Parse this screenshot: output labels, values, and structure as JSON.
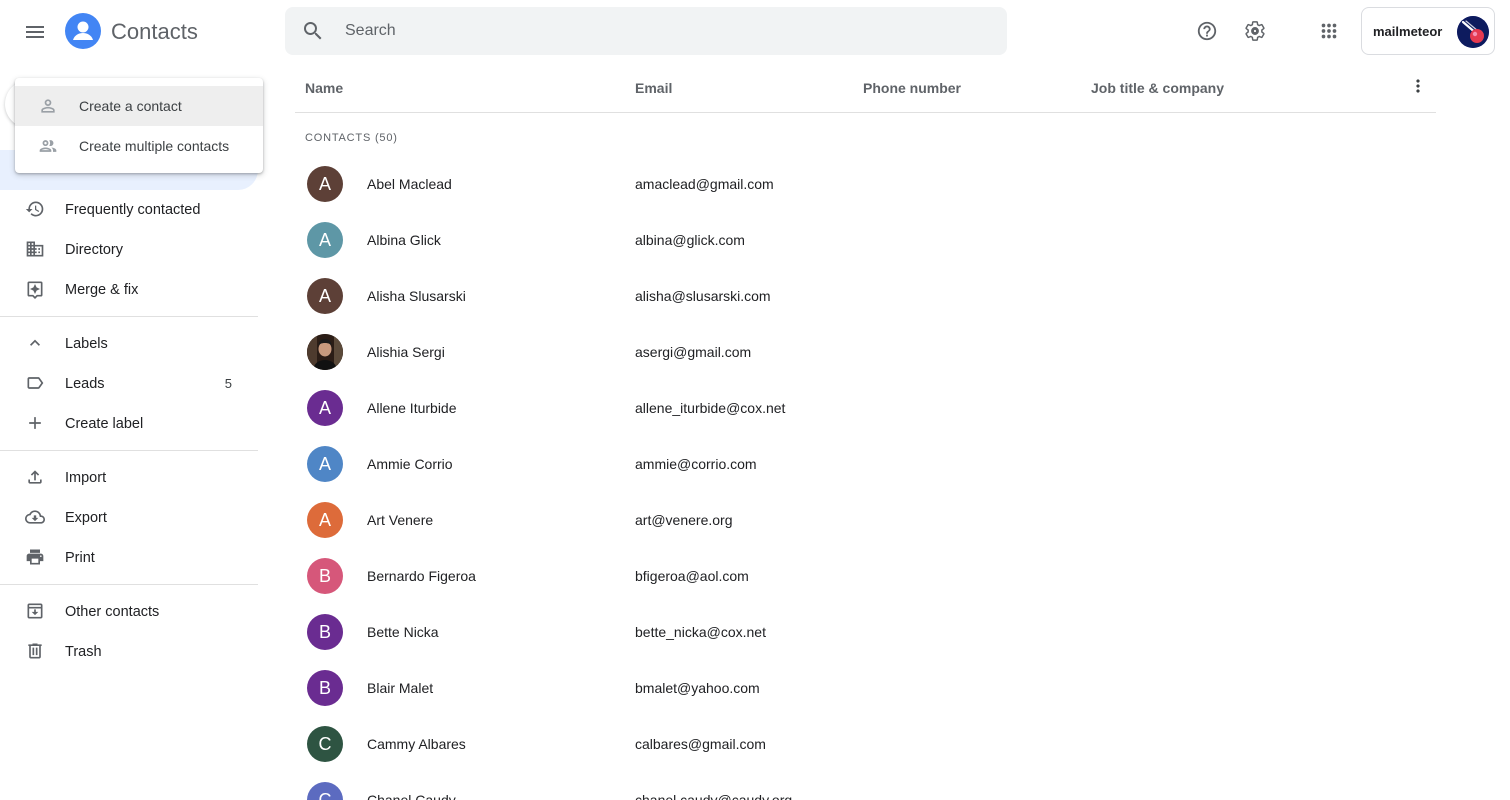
{
  "header": {
    "app_title": "Contacts",
    "search_placeholder": "Search",
    "brand_name": "mailmeteor"
  },
  "dropdown": {
    "items": [
      {
        "label": "Create a contact",
        "icon": "person-icon"
      },
      {
        "label": "Create multiple contacts",
        "icon": "people-icon"
      }
    ]
  },
  "sidebar": {
    "items": [
      {
        "label": "Frequently contacted",
        "icon": "history-icon"
      },
      {
        "label": "Directory",
        "icon": "building-icon"
      },
      {
        "label": "Merge & fix",
        "icon": "merge-fix-icon"
      }
    ],
    "labels_header": "Labels",
    "labels": [
      {
        "label": "Leads",
        "count": "5",
        "icon": "label-icon"
      }
    ],
    "create_label": "Create label",
    "actions": [
      {
        "label": "Import",
        "icon": "upload-icon"
      },
      {
        "label": "Export",
        "icon": "cloud-download-icon"
      },
      {
        "label": "Print",
        "icon": "printer-icon"
      }
    ],
    "bottom": [
      {
        "label": "Other contacts",
        "icon": "archive-icon"
      },
      {
        "label": "Trash",
        "icon": "trash-icon"
      }
    ]
  },
  "list": {
    "columns": {
      "name": "Name",
      "email": "Email",
      "phone": "Phone number",
      "job": "Job title & company"
    },
    "section_title": "CONTACTS (50)",
    "contacts": [
      {
        "initial": "A",
        "name": "Abel Maclead",
        "email": "amaclead@gmail.com",
        "color": "#5d4037"
      },
      {
        "initial": "A",
        "name": "Albina Glick",
        "email": "albina@glick.com",
        "color": "#5e97a6"
      },
      {
        "initial": "A",
        "name": "Alisha Slusarski",
        "email": "alisha@slusarski.com",
        "color": "#5d4037"
      },
      {
        "initial": "",
        "name": "Alishia Sergi",
        "email": "asergi@gmail.com",
        "color": "#3e2723",
        "photo": true
      },
      {
        "initial": "A",
        "name": "Allene Iturbide",
        "email": "allene_iturbide@cox.net",
        "color": "#6a2c91"
      },
      {
        "initial": "A",
        "name": "Ammie Corrio",
        "email": "ammie@corrio.com",
        "color": "#4f86c6"
      },
      {
        "initial": "A",
        "name": "Art Venere",
        "email": "art@venere.org",
        "color": "#dd6b3a"
      },
      {
        "initial": "B",
        "name": "Bernardo Figeroa",
        "email": "bfigeroa@aol.com",
        "color": "#d6577a"
      },
      {
        "initial": "B",
        "name": "Bette Nicka",
        "email": "bette_nicka@cox.net",
        "color": "#6a2c91"
      },
      {
        "initial": "B",
        "name": "Blair Malet",
        "email": "bmalet@yahoo.com",
        "color": "#6a2c91"
      },
      {
        "initial": "C",
        "name": "Cammy Albares",
        "email": "calbares@gmail.com",
        "color": "#2e5442"
      },
      {
        "initial": "C",
        "name": "Chanel Caudy",
        "email": "chanel.caudy@caudy.org",
        "color": "#5c6bc0"
      }
    ]
  }
}
